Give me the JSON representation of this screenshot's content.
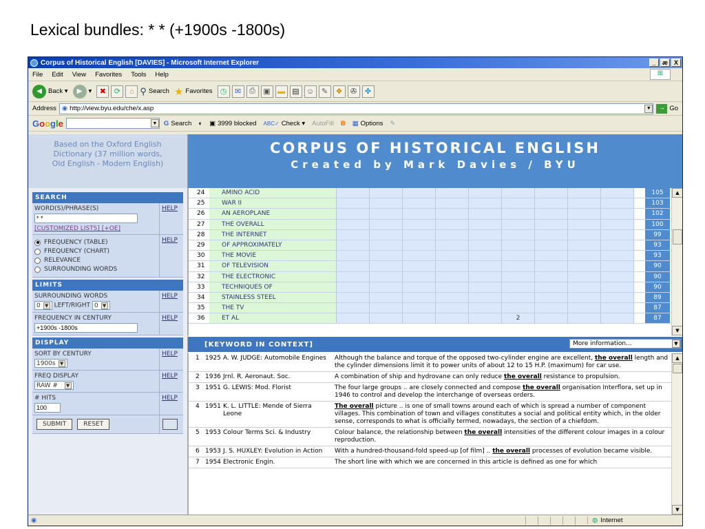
{
  "slide_title": "Lexical bundles: * * (+1900s -1800s)",
  "window": {
    "title": "Corpus of Historical English [DAVIES] - Microsoft Internet Explorer",
    "buttons": [
      "_",
      "æ",
      "X"
    ]
  },
  "menu": [
    "File",
    "Edit",
    "View",
    "Favorites",
    "Tools",
    "Help"
  ],
  "toolbar": {
    "back": "Back",
    "search": "Search",
    "favorites": "Favorites"
  },
  "address": {
    "label": "Address",
    "url": "http://view.byu.edu/che/x.asp",
    "go": "Go"
  },
  "googlebar": {
    "logo": "Google",
    "search": "Search",
    "blocked": "3999 blocked",
    "check": "Check",
    "autofill": "AutoFill",
    "options": "Options"
  },
  "header": {
    "left_line1": "Based on the Oxford English",
    "left_line2": "Dictionary (37 million words,",
    "left_line3": "Old English - Modern English)",
    "banner_title": "CORPUS OF HISTORICAL ENGLISH",
    "banner_subtitle": "Created by Mark Davies / BYU"
  },
  "left_panel": {
    "search_title": "SEARCH",
    "word_label": "WORD(S)/PHRASE(S)",
    "word_value": "* *",
    "help": "HELP",
    "customized": "[CUSTOMIZED LISTS]",
    "oe": "[+OE]",
    "radio_options": [
      "FREQUENCY (TABLE)",
      "FREQUENCY (CHART)",
      "RELEVANCE",
      "SURROUNDING WORDS"
    ],
    "limits_title": "LIMITS",
    "surrounding_label": "SURROUNDING WORDS",
    "left_val": "0",
    "leftright_label": "LEFT/RIGHT",
    "right_val": "0",
    "freq_century_label": "FREQUENCY IN CENTURY",
    "freq_century_value": "+1900s -1800s",
    "display_title": "DISPLAY",
    "sort_label": "SORT BY CENTURY",
    "sort_value": "1900s",
    "freq_display_label": "FREQ DISPLAY",
    "freq_display_value": "RAW #",
    "hits_label": "# HITS",
    "hits_value": "100",
    "submit": "SUBMIT",
    "reset": "RESET"
  },
  "results": [
    {
      "n": "24",
      "word": "AMINO ACID",
      "extra": "",
      "total": "105"
    },
    {
      "n": "25",
      "word": "WAR II",
      "extra": "",
      "total": "103"
    },
    {
      "n": "26",
      "word": "AN AEROPLANE",
      "extra": "",
      "total": "102"
    },
    {
      "n": "27",
      "word": "THE OVERALL",
      "extra": "",
      "total": "100"
    },
    {
      "n": "28",
      "word": "THE INTERNET",
      "extra": "",
      "total": "99"
    },
    {
      "n": "29",
      "word": "OF APPROXIMATELY",
      "extra": "",
      "total": "93"
    },
    {
      "n": "30",
      "word": "THE MOVIE",
      "extra": "",
      "total": "93"
    },
    {
      "n": "31",
      "word": "OF TELEVISION",
      "extra": "",
      "total": "90"
    },
    {
      "n": "32",
      "word": "THE ELECTRONIC",
      "extra": "",
      "total": "90"
    },
    {
      "n": "33",
      "word": "TECHNIQUES OF",
      "extra": "",
      "total": "90"
    },
    {
      "n": "34",
      "word": "STAINLESS STEEL",
      "extra": "",
      "total": "89"
    },
    {
      "n": "35",
      "word": "THE TV",
      "extra": "",
      "total": "87"
    },
    {
      "n": "36",
      "word": "ET AL",
      "extra": "2",
      "total": "87"
    }
  ],
  "kwic": {
    "title": "[KEYWORD IN CONTEXT]",
    "more_info": "More information...",
    "rows": [
      {
        "n": "1",
        "year": "1925",
        "source": "A. W. JUDGE: Automobile Engines",
        "pre": "Although the balance and torque of the opposed two-cylinder engine are excellent, ",
        "kw": "the overall",
        "post": " length and the cylinder dimensions limit it to power units of about 12 to 15 H.P. (maximum) for car use."
      },
      {
        "n": "2",
        "year": "1936",
        "source": "Jrnl. R. Aeronaut. Soc.",
        "pre": "A combination of ship and hydrovane can only reduce ",
        "kw": "the overall",
        "post": " resistance to propulsion."
      },
      {
        "n": "3",
        "year": "1951",
        "source": "G. LEWIS: Mod. Florist",
        "pre": "The four large groups .. are closely connected and compose ",
        "kw": "the overall",
        "post": " organisation Interflora, set up in 1946 to control and develop the interchange of overseas orders."
      },
      {
        "n": "4",
        "year": "1951",
        "source": "K. L. LITTLE: Mende of Sierra Leone",
        "pre": "",
        "kw": "The overall",
        "post": " picture .. is one of small towns around each of which is spread a number of component villages. This combination of town and villages constitutes a social and political entity which, in the older sense, corresponds to what is officially termed, nowadays, the section of a chiefdom."
      },
      {
        "n": "5",
        "year": "1953",
        "source": "Colour Terms Sci. & Industry",
        "pre": "Colour balance, the relationship between ",
        "kw": "the overall",
        "post": " intensities of the different colour images in a colour reproduction."
      },
      {
        "n": "6",
        "year": "1953",
        "source": "J. S. HUXLEY: Evolution in Action",
        "pre": "With a hundred-thousand-fold speed-up [of film] .. ",
        "kw": "the overall",
        "post": " processes of evolution became visible."
      },
      {
        "n": "7",
        "year": "1954",
        "source": "Electronic Engin.",
        "pre": "The short line with which we are concerned in this article is defined as one for which",
        "kw": "",
        "post": ""
      }
    ]
  },
  "status": {
    "zone": "Internet"
  }
}
